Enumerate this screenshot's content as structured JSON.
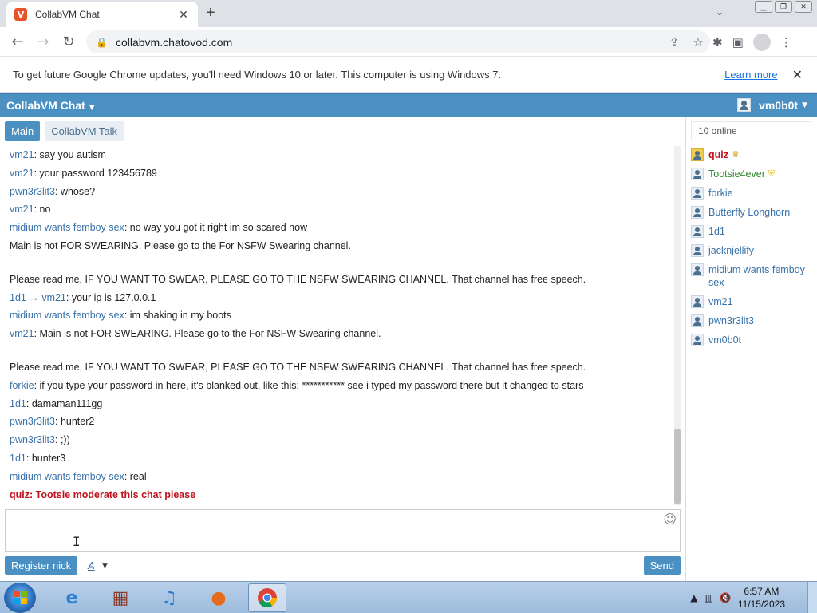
{
  "browser": {
    "tab_title": "CollabVM Chat",
    "favicon_letter": "V",
    "url": "collabvm.chatovod.com",
    "infobar_text": "To get future Google Chrome updates, you'll need Windows 10 or later. This computer is using Windows 7.",
    "learn_more": "Learn more"
  },
  "app": {
    "title": "CollabVM Chat",
    "username": "vm0b0t",
    "accent_color": "#4a90c2"
  },
  "channels": [
    {
      "label": "Main",
      "active": true
    },
    {
      "label": "CollabVM Talk",
      "active": false
    }
  ],
  "messages": [
    {
      "nick": "vm21",
      "text": "say you autism"
    },
    {
      "nick": "vm21",
      "text": "your password 123456789"
    },
    {
      "nick": "pwn3r3lit3",
      "text": "whose?"
    },
    {
      "nick": "vm21",
      "text": "no"
    },
    {
      "nick": "midium wants femboy sex",
      "text": "no way you got it right im so scared now"
    },
    {
      "nick": "",
      "text": "Main is not FOR SWEARING. Please go to the For NSFW Swearing channel."
    },
    {
      "nick": "",
      "text": "Please read me, IF YOU WANT TO SWEAR, PLEASE GO TO THE NSFW SWEARING CHANNEL. That channel has free speech."
    },
    {
      "nick": "1d1",
      "to": "vm21",
      "text": "your ip is 127.0.0.1"
    },
    {
      "nick": "midium wants femboy sex",
      "text": "im shaking in my boots"
    },
    {
      "nick": "vm21",
      "text": "Main is not FOR SWEARING. Please go to the For NSFW Swearing channel."
    },
    {
      "nick": "",
      "text": "Please read me, IF YOU WANT TO SWEAR, PLEASE GO TO THE NSFW SWEARING CHANNEL. That channel has free speech."
    },
    {
      "nick": "forkie",
      "text": "if you type your password in here, it's blanked out, like this: *********** see i typed my password there but it changed to stars"
    },
    {
      "nick": "1d1",
      "text": "damaman111gg"
    },
    {
      "nick": "pwn3r3lit3",
      "text": "hunter2"
    },
    {
      "nick": "pwn3r3lit3",
      "text": ";))"
    },
    {
      "nick": "1d1",
      "text": "hunter3"
    },
    {
      "nick": "midium wants femboy sex",
      "text": "real"
    },
    {
      "nick": "quiz",
      "text": "Tootsie moderate this chat please",
      "admin": true
    }
  ],
  "composer": {
    "register_label": "Register nick",
    "format_label": "A",
    "send_label": "Send"
  },
  "sidebar": {
    "online_count": "10 online",
    "users": [
      {
        "name": "quiz",
        "role": "admin",
        "badge": "crown"
      },
      {
        "name": "Tootsie4ever",
        "role": "mod",
        "badge": "shield"
      },
      {
        "name": "forkie",
        "role": "user"
      },
      {
        "name": "Butterfly Longhorn",
        "role": "user"
      },
      {
        "name": "1d1",
        "role": "user"
      },
      {
        "name": "jacknjellify",
        "role": "user"
      },
      {
        "name": "midium wants femboy sex",
        "role": "user"
      },
      {
        "name": "vm21",
        "role": "user"
      },
      {
        "name": "pwn3r3lit3",
        "role": "user"
      },
      {
        "name": "vm0b0t",
        "role": "user"
      }
    ]
  },
  "taskbar": {
    "apps": [
      "start-orb",
      "internet-explorer",
      "media-center",
      "itunes",
      "firefox",
      "chrome"
    ],
    "time": "6:57 AM",
    "date": "11/15/2023"
  }
}
